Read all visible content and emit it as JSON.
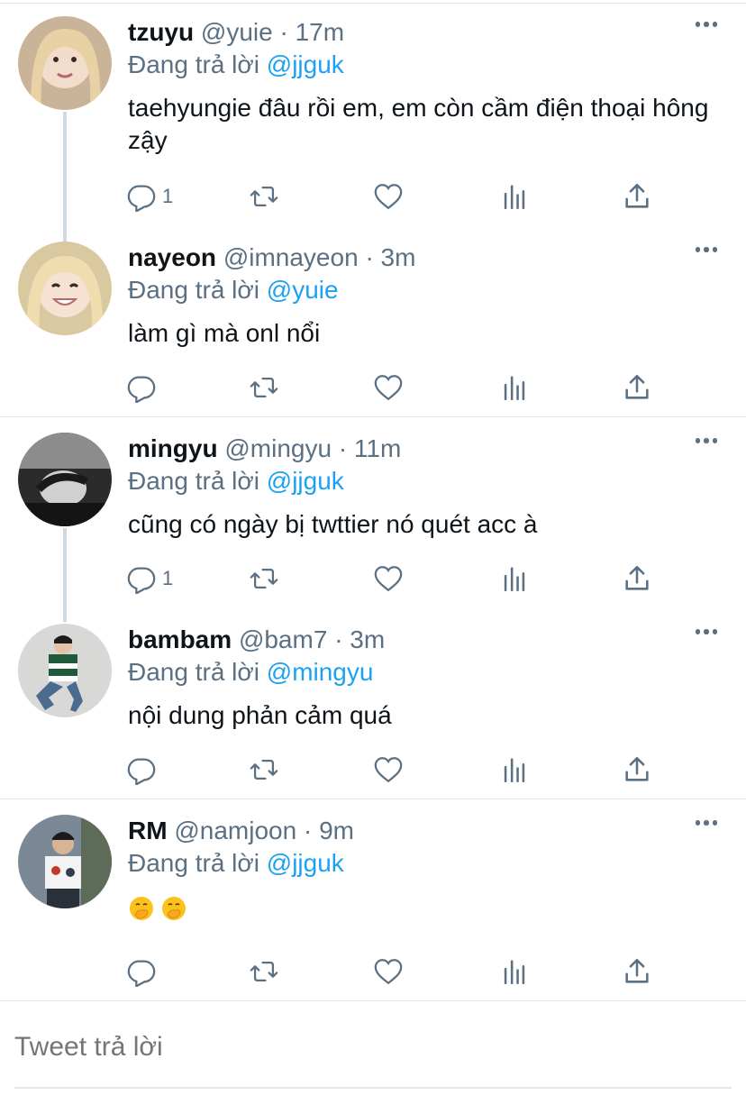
{
  "colors": {
    "accent": "#1da1f2",
    "secondary_text": "#5b7083",
    "primary_text": "#0f1419",
    "border": "#e1e8ed",
    "thread_line": "#cfd9de"
  },
  "replying_label": "Đang trả lời",
  "tweets": [
    {
      "name": "tzuyu",
      "handle": "@yuie",
      "dot": "·",
      "time": "17m",
      "reply_to": "@jjguk",
      "text": "taehyungie đâu rồi em, em còn cầm điện thoại hông zậy",
      "reply_count": "1",
      "avatar_icon": "avatar-photo-blonde"
    },
    {
      "name": "nayeon",
      "handle": "@imnayeon",
      "dot": "·",
      "time": "3m",
      "reply_to": "@yuie",
      "text": "làm gì mà onl nổi",
      "reply_count": "",
      "avatar_icon": "avatar-photo-smiling"
    },
    {
      "name": "mingyu",
      "handle": "@mingyu",
      "dot": "·",
      "time": "11m",
      "reply_to": "@jjguk",
      "text": "cũng có ngày bị twttier nó quét acc à",
      "reply_count": "1",
      "avatar_icon": "avatar-photo-monochrome"
    },
    {
      "name": "bambam",
      "handle": "@bam7",
      "dot": "·",
      "time": "3m",
      "reply_to": "@mingyu",
      "text": "nội dung phản cảm quá",
      "reply_count": "",
      "avatar_icon": "avatar-photo-striped-sweater"
    },
    {
      "name": "RM",
      "handle": "@namjoon",
      "dot": "·",
      "time": "9m",
      "reply_to": "@jjguk",
      "text": "",
      "emojis": [
        "face-with-hand-over-mouth-emoji",
        "face-with-hand-over-mouth-emoji"
      ],
      "reply_count": "",
      "avatar_icon": "avatar-photo-outdoor"
    }
  ],
  "action_icons": [
    "reply-icon",
    "retweet-icon",
    "like-icon",
    "analytics-icon",
    "share-icon"
  ],
  "reply_box": {
    "placeholder": "Tweet trả lời"
  }
}
